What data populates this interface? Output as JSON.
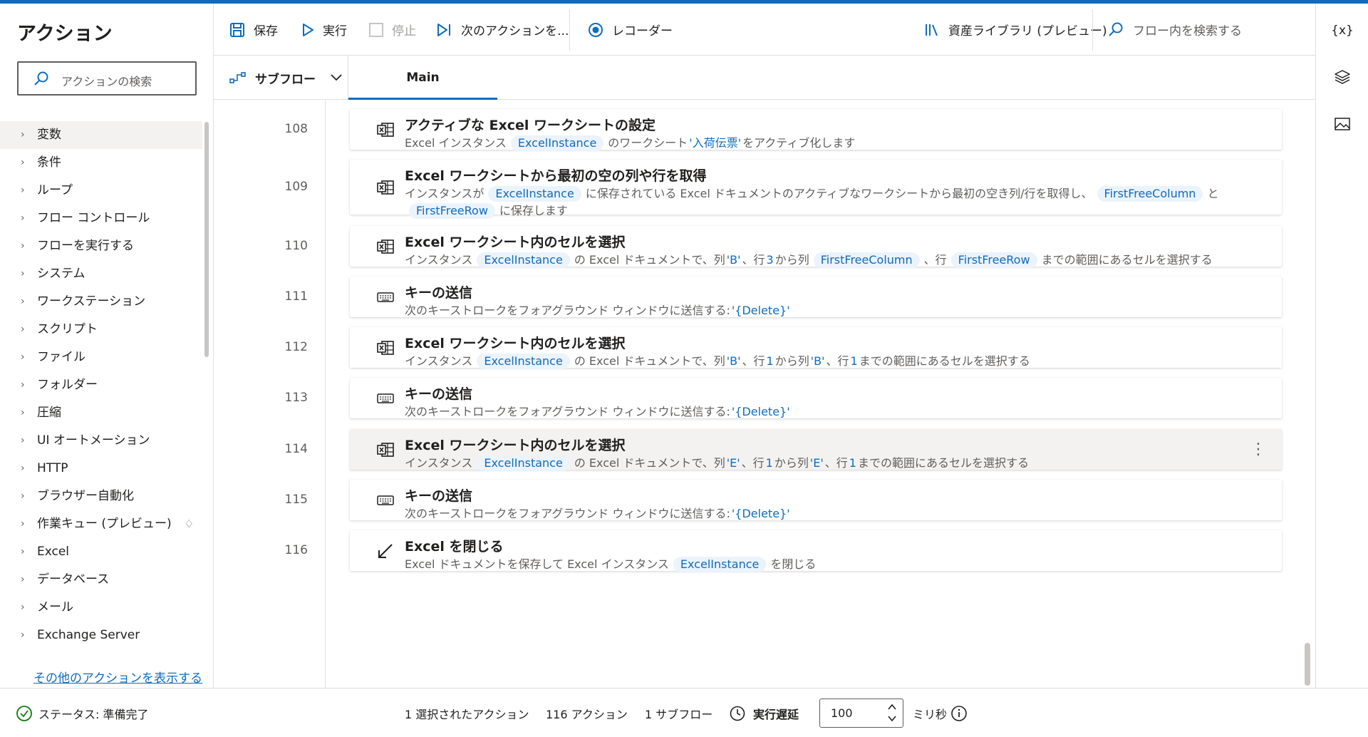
{
  "left_panel": {
    "title": "アクション",
    "search_placeholder": "アクションの検索",
    "categories": [
      {
        "label": "変数"
      },
      {
        "label": "条件"
      },
      {
        "label": "ループ"
      },
      {
        "label": "フロー コントロール"
      },
      {
        "label": "フローを実行する"
      },
      {
        "label": "システム"
      },
      {
        "label": "ワークステーション"
      },
      {
        "label": "スクリプト"
      },
      {
        "label": "ファイル"
      },
      {
        "label": "フォルダー"
      },
      {
        "label": "圧縮"
      },
      {
        "label": "UI オートメーション"
      },
      {
        "label": "HTTP"
      },
      {
        "label": "ブラウザー自動化"
      },
      {
        "label": "作業キュー (プレビュー)"
      },
      {
        "label": "Excel"
      },
      {
        "label": "データベース"
      },
      {
        "label": "メール"
      },
      {
        "label": "Exchange Server"
      }
    ],
    "more_link": "その他のアクションを表示する"
  },
  "toolbar": {
    "save": "保存",
    "run": "実行",
    "stop": "停止",
    "next_action": "次のアクションを...",
    "recorder": "レコーダー",
    "asset_library": "資産ライブラリ (プレビュー)",
    "flow_search_placeholder": "フロー内を検索する"
  },
  "tabs": {
    "subflow": "サブフロー",
    "main": "Main"
  },
  "rail": {
    "variables": "{x}"
  },
  "steps": [
    {
      "line": "108",
      "icon": "excel-icon",
      "title": "アクティブな Excel ワークシートの設定",
      "d": [
        "Excel インスタンス",
        "ExcelInstance",
        "のワークシート",
        "'入荷伝票'",
        "をアクティブ化します"
      ]
    },
    {
      "line": "109",
      "icon": "excel-icon",
      "title": "Excel ワークシートから最初の空の列や行を取得",
      "d": [
        "インスタンスが",
        "ExcelInstance",
        "に保存されている Excel ドキュメントのアクティブなワークシートから最初の空き列/行を取得し、",
        "FirstFreeColumn",
        "と",
        "FirstFreeRow",
        "に保存します"
      ]
    },
    {
      "line": "110",
      "icon": "excel-icon",
      "title": "Excel ワークシート内のセルを選択",
      "d": [
        "インスタンス",
        "ExcelInstance",
        "の Excel ドキュメントで、列",
        "'B'",
        "、行",
        "3",
        "から列",
        "FirstFreeColumn",
        "、行",
        "FirstFreeRow",
        "までの範囲にあるセルを選択する"
      ]
    },
    {
      "line": "111",
      "icon": "keyboard-icon",
      "title": "キーの送信",
      "d": [
        "次のキーストロークをフォアグラウンド ウィンドウに送信する:",
        "'{Delete}'"
      ]
    },
    {
      "line": "112",
      "icon": "excel-icon",
      "title": "Excel ワークシート内のセルを選択",
      "d": [
        "インスタンス",
        "ExcelInstance",
        "の Excel ドキュメントで、列",
        "'B'",
        "、行",
        "1",
        "から列",
        "'B'",
        "、行",
        "1",
        "までの範囲にあるセルを選択する"
      ]
    },
    {
      "line": "113",
      "icon": "keyboard-icon",
      "title": "キーの送信",
      "d": [
        "次のキーストロークをフォアグラウンド ウィンドウに送信する:",
        "'{Delete}'"
      ]
    },
    {
      "line": "114",
      "icon": "excel-icon",
      "title": "Excel ワークシート内のセルを選択",
      "d": [
        "インスタンス",
        "ExcelInstance",
        "の Excel ドキュメントで、列",
        "'E'",
        "、行",
        "1",
        "から列",
        "'E'",
        "、行",
        "1",
        "までの範囲にあるセルを選択する"
      ]
    },
    {
      "line": "115",
      "icon": "keyboard-icon",
      "title": "キーの送信",
      "d": [
        "次のキーストロークをフォアグラウンド ウィンドウに送信する:",
        "'{Delete}'"
      ]
    },
    {
      "line": "116",
      "icon": "close-arrow-icon",
      "title": "Excel を閉じる",
      "d": [
        "Excel ドキュメントを保存して Excel インスタンス",
        "ExcelInstance",
        "を閉じる"
      ]
    }
  ],
  "status": {
    "status_text": "ステータス: 準備完了",
    "selected": "1 選択されたアクション",
    "actions_count": "116 アクション",
    "subflows": "1 サブフロー",
    "delay_label": "実行遅延",
    "delay_value": "100",
    "unit": "ミリ秒"
  },
  "colors": {
    "accent": "#0f6cbd",
    "chip_bg": "#ebf3fc",
    "status_ok": "#107c10"
  }
}
